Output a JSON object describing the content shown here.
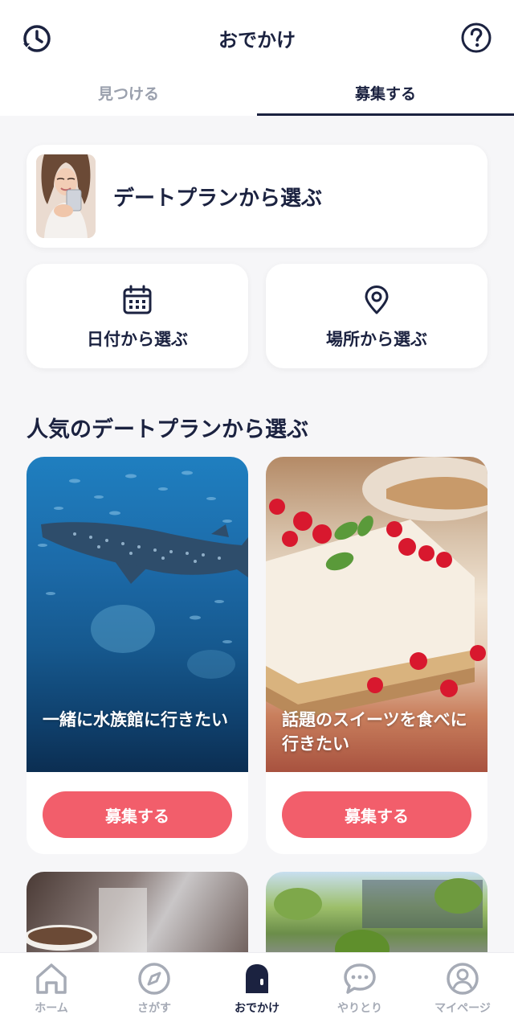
{
  "header": {
    "title": "おでかけ",
    "left_icon": "history-icon",
    "right_icon": "help-icon"
  },
  "tabs": [
    {
      "label": "見つける",
      "active": false
    },
    {
      "label": "募集する",
      "active": true
    }
  ],
  "plan_card": {
    "label": "デートプランから選ぶ"
  },
  "date_card": {
    "label": "日付から選ぶ",
    "icon": "calendar-icon"
  },
  "place_card": {
    "label": "場所から選ぶ",
    "icon": "map-pin-icon"
  },
  "section": {
    "title": "人気のデートプランから選ぶ"
  },
  "features": [
    {
      "caption": "一緒に水族館に行きたい",
      "button": "募集する"
    },
    {
      "caption": "話題のスイーツを食べに行きたい",
      "button": "募集する"
    }
  ],
  "bottom_nav": [
    {
      "label": "ホーム",
      "icon": "home-icon",
      "active": false
    },
    {
      "label": "さがす",
      "icon": "compass-icon",
      "active": false
    },
    {
      "label": "おでかけ",
      "icon": "door-icon",
      "active": true
    },
    {
      "label": "やりとり",
      "icon": "chat-icon",
      "active": false
    },
    {
      "label": "マイページ",
      "icon": "user-icon",
      "active": false
    }
  ],
  "colors": {
    "navy": "#1b2240",
    "accent": "#f25e6b",
    "inactive": "#a6abb6"
  }
}
